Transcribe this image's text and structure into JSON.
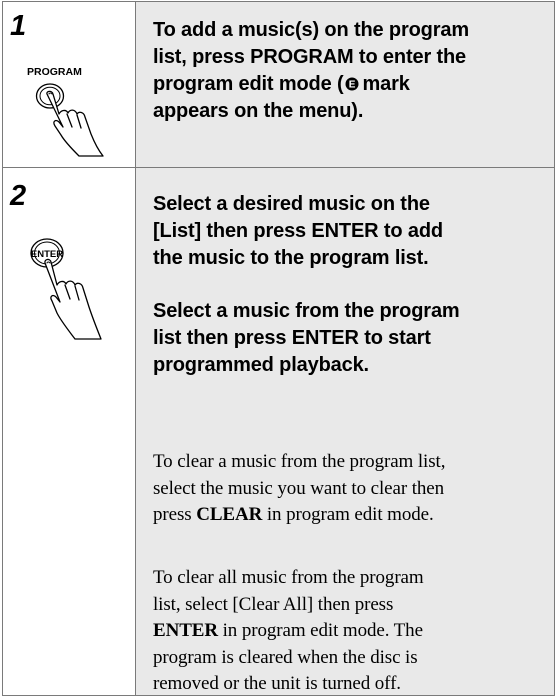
{
  "steps": [
    {
      "number": "1",
      "button_label": "PROGRAM",
      "instruction": {
        "line1": "To add a music(s) on the program",
        "line2": "list, press PROGRAM to enter the",
        "line3_a": "program edit mode (",
        "line3_b": "mark",
        "line4": "appears on the menu)."
      },
      "mark_letter": "E"
    },
    {
      "number": "2",
      "button_label": "ENTER",
      "instruction_a": {
        "line1": "Select a desired music on the",
        "line2": "[List] then press ENTER to add",
        "line3": "the music to the program list."
      },
      "instruction_b": {
        "line1": "Select a music from the program",
        "line2": "list then press ENTER to start",
        "line3": "programmed playback."
      },
      "note_clear": {
        "line1": "To clear a music from the program list,",
        "line2": "select the music you want to clear then",
        "line3_a": "press ",
        "line3_key": "CLEAR",
        "line3_b": " in program edit mode."
      },
      "note_clear_all": {
        "line1": "To clear all music from the program",
        "line2": "list, select [Clear All] then press",
        "line3_key": "ENTER",
        "line3_b": " in program edit mode. The",
        "line4": "program is cleared when the disc is",
        "line5": "removed or the unit is turned off."
      }
    }
  ],
  "colors": {
    "border": "#7a7a7a",
    "shade": "#e9e9e9",
    "text": "#000000"
  },
  "icons": [
    "hand-pressing-icon",
    "program-mark-icon"
  ]
}
